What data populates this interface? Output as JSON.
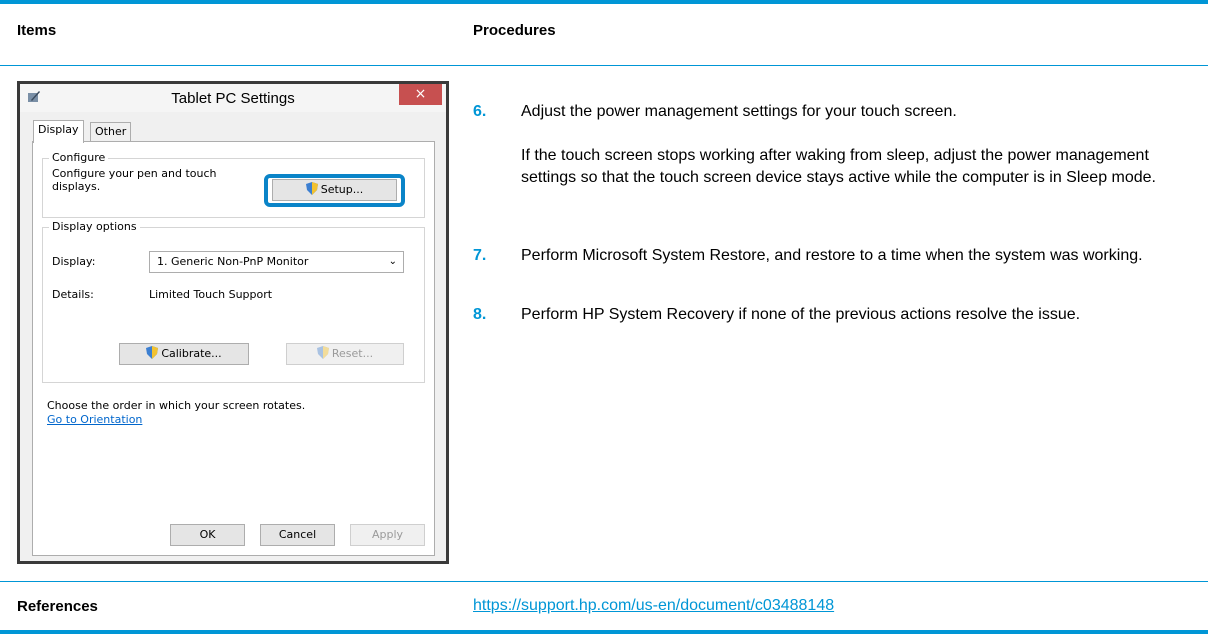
{
  "table": {
    "col_items": "Items",
    "col_procedures": "Procedures",
    "references_label": "References",
    "references_link": "https://support.hp.com/us-en/document/c03488148"
  },
  "dialog": {
    "title": "Tablet PC Settings",
    "close_glyph": "×",
    "tabs": [
      "Display",
      "Other"
    ],
    "configure": {
      "group_title": "Configure",
      "text": "Configure your pen and touch displays.",
      "setup_button": "Setup..."
    },
    "display_options": {
      "group_title": "Display options",
      "display_label": "Display:",
      "display_value": "1. Generic Non-PnP Monitor",
      "details_label": "Details:",
      "details_value": "Limited Touch Support",
      "calibrate_button": "Calibrate...",
      "reset_button": "Reset..."
    },
    "orientation_text": "Choose the order in which your screen rotates.",
    "orientation_link": "Go to Orientation",
    "ok_button": "OK",
    "cancel_button": "Cancel",
    "apply_button": "Apply"
  },
  "procedures": [
    {
      "num": "6.",
      "text": "Adjust the power management settings for your touch screen."
    },
    {
      "num": "7.",
      "text": "Perform Microsoft System Restore, and restore to a time when the system was working."
    },
    {
      "num": "8.",
      "text": "Perform HP System Recovery if none of the previous actions resolve the issue."
    }
  ],
  "step6_note": "If the touch screen stops working after waking from sleep, adjust the power management settings so that the touch screen device stays active while the computer is in Sleep mode.",
  "colors": {
    "accent": "#0096d6",
    "highlight": "#0a84c8",
    "close": "#c75050"
  }
}
